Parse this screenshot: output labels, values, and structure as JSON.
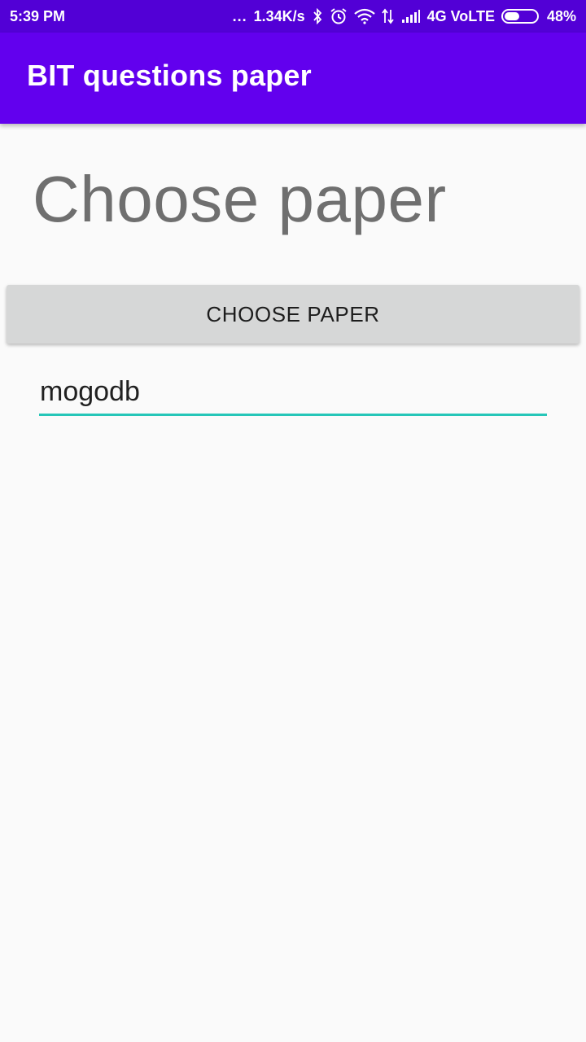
{
  "status_bar": {
    "time": "5:39 PM",
    "more": "...",
    "speed": "1.34K/s",
    "network": "4G VoLTE",
    "battery": "48%",
    "icons": [
      "bluetooth-icon",
      "alarm-icon",
      "wifi-icon",
      "data-transfer-icon",
      "signal-icon",
      "battery-icon"
    ],
    "battery_level": 0.48
  },
  "app_bar": {
    "title": "BIT questions paper",
    "color": "#6200ee"
  },
  "main": {
    "heading": "Choose paper",
    "button_label": "CHOOSE PAPER",
    "field_value": "mogodb",
    "field_accent": "#26c6b8"
  }
}
